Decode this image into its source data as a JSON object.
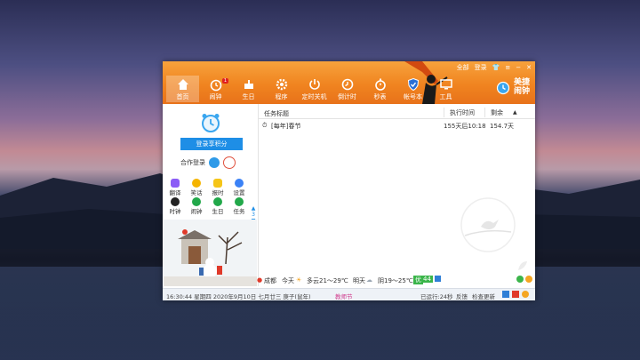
{
  "window": {
    "controls": {
      "all_label": "全部",
      "login_label": "登录"
    },
    "brand": {
      "line1": "美捷",
      "line2": "闹钟"
    }
  },
  "nav": {
    "items": [
      {
        "label": "首页",
        "icon": "home-icon"
      },
      {
        "label": "闹钟",
        "icon": "alarm-icon",
        "badge": "1"
      },
      {
        "label": "生日",
        "icon": "cake-icon"
      },
      {
        "label": "程序",
        "icon": "gear-icon"
      },
      {
        "label": "定时关机",
        "icon": "power-icon"
      },
      {
        "label": "倒计时",
        "icon": "countdown-icon"
      },
      {
        "label": "秒表",
        "icon": "stopwatch-icon"
      },
      {
        "label": "帐号本",
        "icon": "shield-icon"
      },
      {
        "label": "工具",
        "icon": "monitor-icon"
      }
    ]
  },
  "sidebar": {
    "login_button": "登录享积分",
    "coop_login": "合作登录",
    "grid": [
      [
        {
          "label": "翻译",
          "color": "#8b5cf6"
        },
        {
          "label": "笑话",
          "color": "#f5b400"
        },
        {
          "label": "报时",
          "color": "#f5c518"
        },
        {
          "label": "设置",
          "color": "#3b82f6"
        }
      ],
      [
        {
          "label": "时钟",
          "color": "#222222"
        },
        {
          "label": "闹钟",
          "color": "#22a84a"
        },
        {
          "label": "生日",
          "color": "#22a84a"
        },
        {
          "label": "任务",
          "color": "#22a84a"
        }
      ]
    ],
    "page_indicator": "3"
  },
  "table": {
    "headers": {
      "title": "任务标题",
      "time": "执行时间",
      "remain": "剩余"
    },
    "rows": [
      {
        "title": "[每年]春节",
        "time": "155天后10:18",
        "remain": "154.7天"
      }
    ]
  },
  "weather": {
    "city": "成都",
    "today_label": "今天",
    "today": "多云21～29℃",
    "tomorrow_label": "明天",
    "tomorrow": "阴19～25℃",
    "aqi_label": "优",
    "aqi": "44"
  },
  "statusbar": {
    "datetime": "16:30:44 星期四 2020年9月10日 七月廿三 庚子(鼠年)",
    "festival": "教师节",
    "running": "已运行:24秒",
    "feedback": "反馈",
    "update": "检查更新"
  },
  "colors": {
    "accent": "#f08420",
    "button": "#1e8ee6",
    "festival": "#d0368a"
  }
}
